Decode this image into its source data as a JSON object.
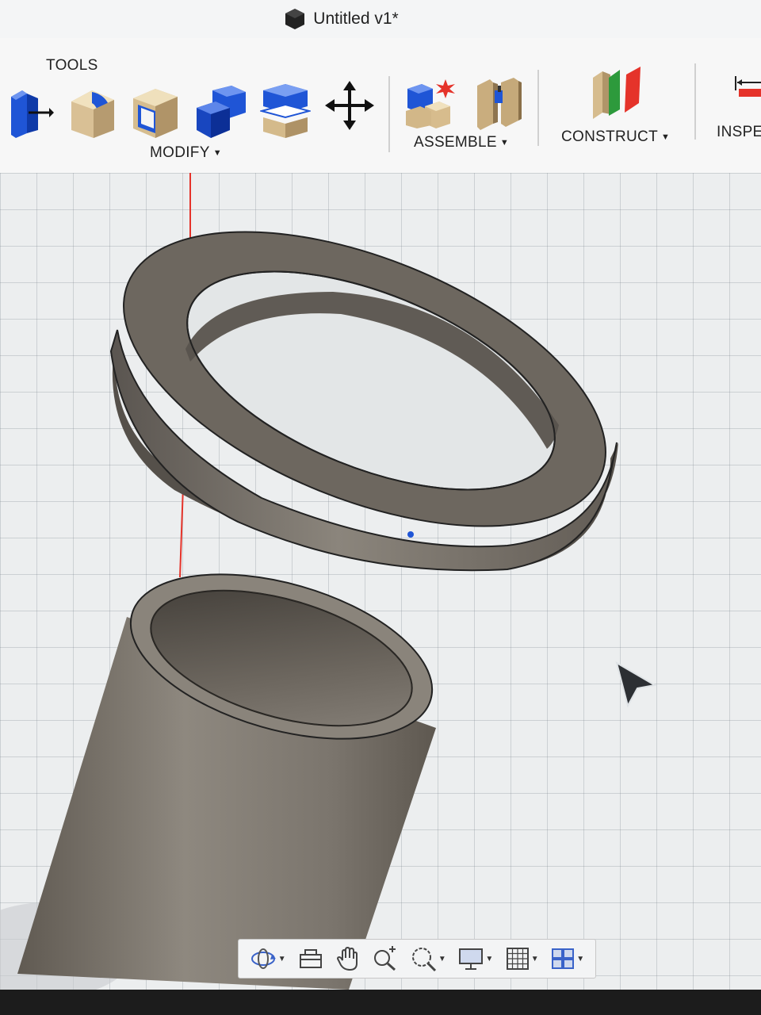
{
  "window": {
    "title": "Untitled v1*"
  },
  "toolbar": {
    "tools_label": "TOOLS",
    "modify_label": "MODIFY",
    "assemble_label": "ASSEMBLE",
    "construct_label": "CONSTRUCT",
    "inspect_label": "INSPE",
    "caret": "▼"
  },
  "icons": {
    "modify": [
      "press-pull-icon",
      "fillet-icon",
      "shell-icon",
      "combine-icon",
      "split-body-icon",
      "move-icon"
    ],
    "assemble": [
      "new-component-icon",
      "joint-icon"
    ],
    "construct": [
      "offset-plane-icon"
    ],
    "inspect": [
      "measure-icon"
    ],
    "navbar": [
      "orbit-icon",
      "look-at-icon",
      "pan-icon",
      "zoom-icon",
      "fit-icon",
      "display-settings-icon",
      "grid-settings-icon",
      "viewports-icon"
    ]
  },
  "colors": {
    "accent_blue": "#1f55d6",
    "body_gray": "#6f6a64",
    "axis_red": "#e5332a"
  }
}
